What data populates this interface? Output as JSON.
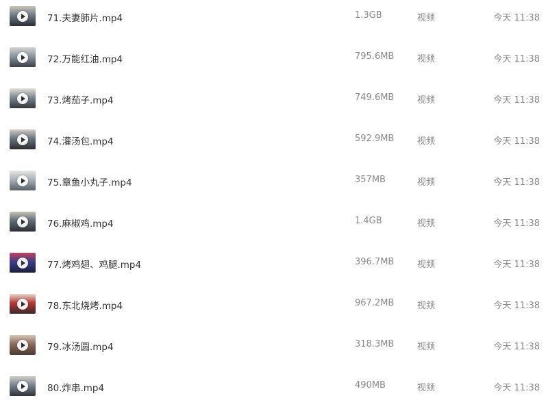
{
  "files": [
    {
      "name": "71.夫妻肺片.mp4",
      "size": "1.3GB",
      "type": "视频",
      "time": "今天 11:38",
      "thumb_colors": [
        "#6f7a86",
        "#c9c3b5",
        "#2c2f35"
      ]
    },
    {
      "name": "72.万能红油.mp4",
      "size": "795.6MB",
      "type": "视频",
      "time": "今天 11:38",
      "thumb_colors": [
        "#8a96a0",
        "#d6d4cf",
        "#3a3f44"
      ]
    },
    {
      "name": "73.烤茄子.mp4",
      "size": "749.6MB",
      "type": "视频",
      "time": "今天 11:38",
      "thumb_colors": [
        "#7d8892",
        "#e2ded6",
        "#34383d"
      ]
    },
    {
      "name": "74.灌汤包.mp4",
      "size": "592.9MB",
      "type": "视频",
      "time": "今天 11:38",
      "thumb_colors": [
        "#6b7680",
        "#cfcac0",
        "#2a2d31"
      ]
    },
    {
      "name": "75.章鱼小丸子.mp4",
      "size": "357MB",
      "type": "视频",
      "time": "今天 11:38",
      "thumb_colors": [
        "#a8b2ba",
        "#e8e6e2",
        "#5a6168"
      ]
    },
    {
      "name": "76.麻椒鸡.mp4",
      "size": "1.4GB",
      "type": "视频",
      "time": "今天 11:38",
      "thumb_colors": [
        "#5f6b76",
        "#c7c2b8",
        "#2b2f34"
      ]
    },
    {
      "name": "77.烤鸡翅、鸡腿.mp4",
      "size": "396.7MB",
      "type": "视频",
      "time": "今天 11:38",
      "thumb_colors": [
        "#3b3f8a",
        "#c93f5a",
        "#1d1f3a"
      ]
    },
    {
      "name": "78.东北烧烤.mp4",
      "size": "967.2MB",
      "type": "视频",
      "time": "今天 11:38",
      "thumb_colors": [
        "#b73a36",
        "#e4d7cf",
        "#3a2a2a"
      ]
    },
    {
      "name": "79.冰汤圆.mp4",
      "size": "318.3MB",
      "type": "视频",
      "time": "今天 11:38",
      "thumb_colors": [
        "#8c6b5a",
        "#d8c7b8",
        "#4a3a32"
      ]
    },
    {
      "name": "80.炸串.mp4",
      "size": "490MB",
      "type": "视频",
      "time": "今天 11:38",
      "thumb_colors": [
        "#7a8590",
        "#d3cfc7",
        "#30343a"
      ]
    }
  ]
}
